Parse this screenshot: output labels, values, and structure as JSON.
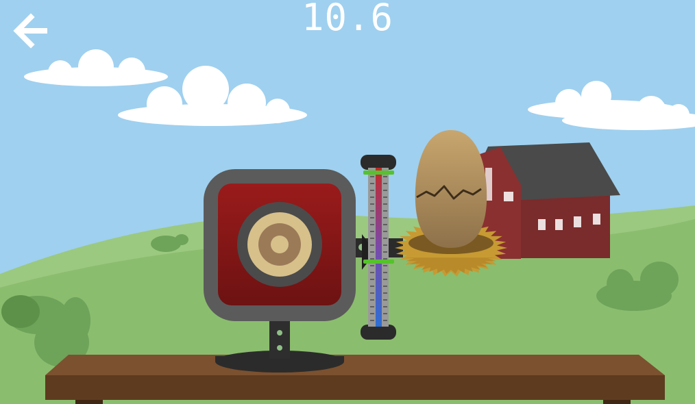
{
  "hud": {
    "timer": "10.6"
  },
  "icons": {
    "back": "arrow-left-icon"
  },
  "colors": {
    "sky": "#9fd0ef",
    "hill": "#8bbd6e",
    "barn": "#7a2b2b",
    "barn_roof": "#4a4a4a",
    "table": "#6b4426",
    "speaker_body": "#8c1818",
    "speaker_frame": "#5b5b5b",
    "egg": "#b89563",
    "nest": "#c79a33",
    "meter_green": "#56c22c",
    "meter_red": "#c42a2a",
    "meter_blue": "#2d6fd4"
  },
  "meter": {
    "level_fraction": 0.4
  }
}
